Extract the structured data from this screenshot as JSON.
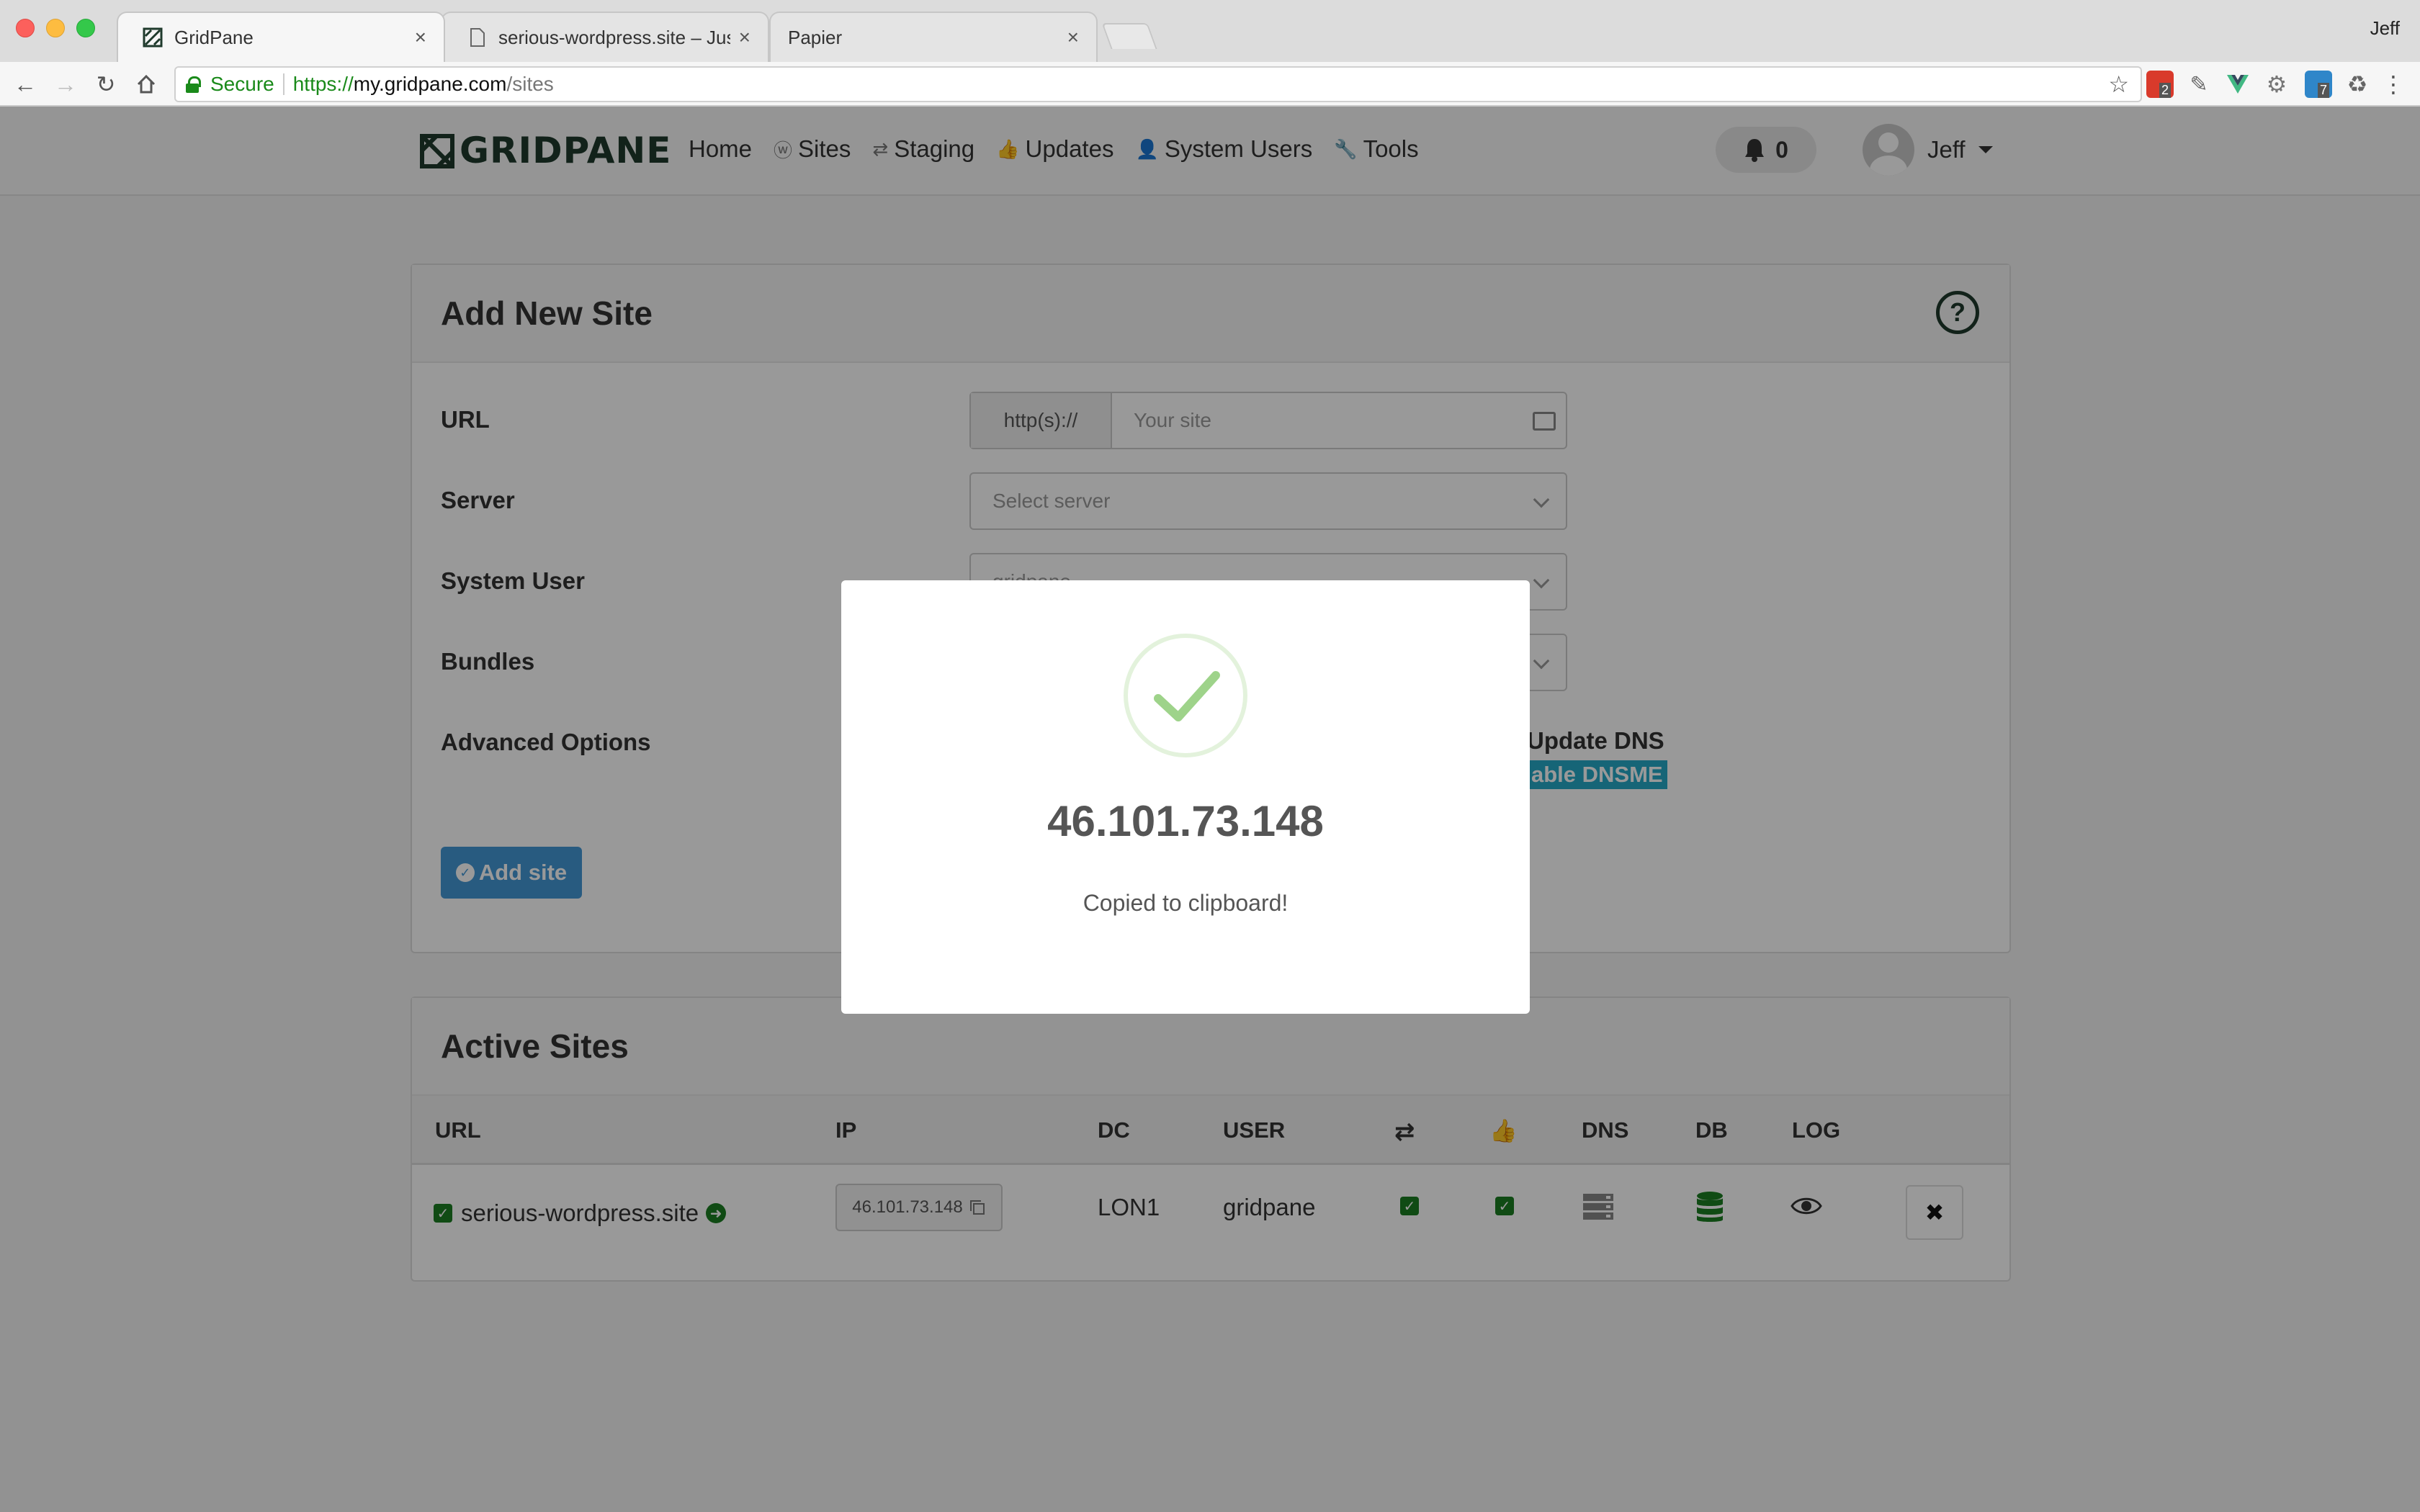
{
  "browser": {
    "tabs": [
      {
        "label": "GridPane",
        "active": true
      },
      {
        "label": "serious-wordpress.site – Just a",
        "active": false
      },
      {
        "label": "Papier",
        "active": false
      }
    ],
    "tab_close": "×",
    "profile_name": "Jeff",
    "address": {
      "secure_label": "Secure",
      "protocol": "https://",
      "host": "my.gridpane.com",
      "path": "/sites"
    },
    "extension_badges": [
      "2",
      "7"
    ]
  },
  "app": {
    "logo_text": "GRIDPANE",
    "nav": [
      {
        "label": "Home",
        "icon": ""
      },
      {
        "label": "Sites",
        "icon": "wordpress-icon"
      },
      {
        "label": "Staging",
        "icon": "retweet-icon"
      },
      {
        "label": "Updates",
        "icon": "thumbs-up-icon"
      },
      {
        "label": "System Users",
        "icon": "user-icon"
      },
      {
        "label": "Tools",
        "icon": "wrench-icon"
      }
    ],
    "notification_count": "0",
    "user_name": "Jeff"
  },
  "add_site": {
    "title": "Add New Site",
    "url_label": "URL",
    "url_addon": "http(s)://",
    "url_placeholder": "Your site",
    "server_label": "Server",
    "server_placeholder": "Select server",
    "system_user_label": "System User",
    "system_user_value": "gridpane",
    "bundles_label": "Bundles",
    "advanced_label": "Advanced Options",
    "update_dns_text": "Update DNS",
    "dnsme_text": "able DNSME",
    "add_button": "Add site"
  },
  "active_sites": {
    "title": "Active Sites",
    "columns": [
      "URL",
      "IP",
      "DC",
      "USER",
      "DNS",
      "DB",
      "LOG"
    ],
    "rows": [
      {
        "url": "serious-wordpress.site",
        "ip": "46.101.73.148",
        "dc": "LON1",
        "user": "gridpane"
      }
    ],
    "remove_icon": "✖"
  },
  "modal": {
    "ip": "46.101.73.148",
    "message": "Copied to clipboard!"
  },
  "colors": {
    "brand": "#1f3a2c",
    "primary_button": "#4398d6",
    "success": "#1b7d22",
    "dnsme_highlight": "#25a9c7",
    "checkmark": "#9ed38a"
  }
}
